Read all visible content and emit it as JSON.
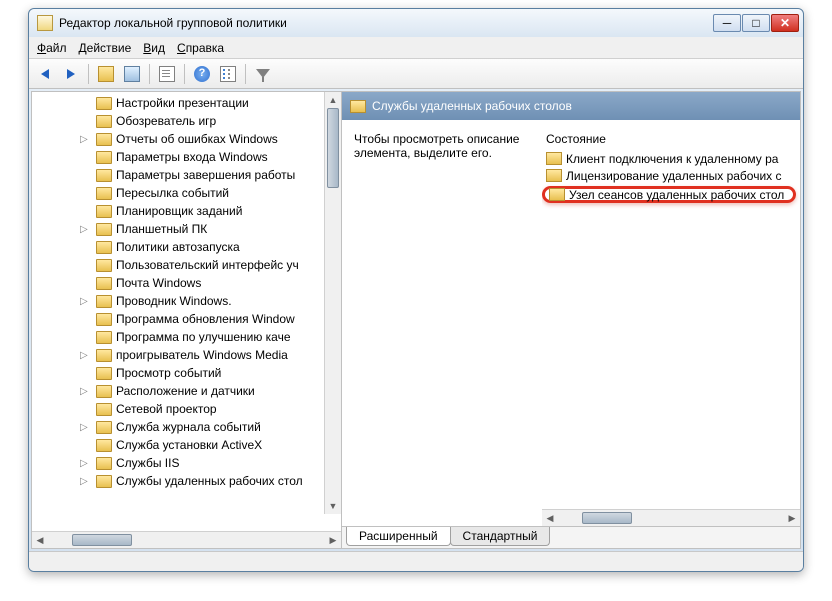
{
  "window": {
    "title": "Редактор локальной групповой политики"
  },
  "menubar": {
    "file": "Файл",
    "action": "Действие",
    "view": "Вид",
    "help": "Справка"
  },
  "tree": {
    "items": [
      {
        "label": "Настройки презентации",
        "expandable": false
      },
      {
        "label": "Обозреватель игр",
        "expandable": false
      },
      {
        "label": "Отчеты об ошибках Windows",
        "expandable": true
      },
      {
        "label": "Параметры входа Windows",
        "expandable": false
      },
      {
        "label": "Параметры завершения работы",
        "expandable": false
      },
      {
        "label": "Пересылка событий",
        "expandable": false
      },
      {
        "label": "Планировщик заданий",
        "expandable": false
      },
      {
        "label": "Планшетный ПК",
        "expandable": true
      },
      {
        "label": "Политики автозапуска",
        "expandable": false
      },
      {
        "label": "Пользовательский интерфейс уч",
        "expandable": false
      },
      {
        "label": "Почта Windows",
        "expandable": false
      },
      {
        "label": "Проводник Windows.",
        "expandable": true
      },
      {
        "label": "Программа обновления Window",
        "expandable": false
      },
      {
        "label": "Программа по улучшению каче",
        "expandable": false
      },
      {
        "label": "проигрыватель Windows Media",
        "expandable": true
      },
      {
        "label": "Просмотр событий",
        "expandable": false
      },
      {
        "label": "Расположение и датчики",
        "expandable": true
      },
      {
        "label": "Сетевой проектор",
        "expandable": false
      },
      {
        "label": "Служба журнала событий",
        "expandable": true
      },
      {
        "label": "Служба установки ActiveX",
        "expandable": false
      },
      {
        "label": "Службы IIS",
        "expandable": true
      },
      {
        "label": "Службы удаленных рабочих стол",
        "expandable": true
      }
    ]
  },
  "detail": {
    "header_title": "Службы удаленных рабочих столов",
    "description": "Чтобы просмотреть описание элемента, выделите его.",
    "state_heading": "Состояние",
    "items": [
      {
        "label": "Клиент подключения к удаленному ра"
      },
      {
        "label": "Лицензирование удаленных рабочих с"
      },
      {
        "label": "Узел сеансов удаленных рабочих стол"
      }
    ]
  },
  "tabs": {
    "extended": "Расширенный",
    "standard": "Стандартный"
  }
}
